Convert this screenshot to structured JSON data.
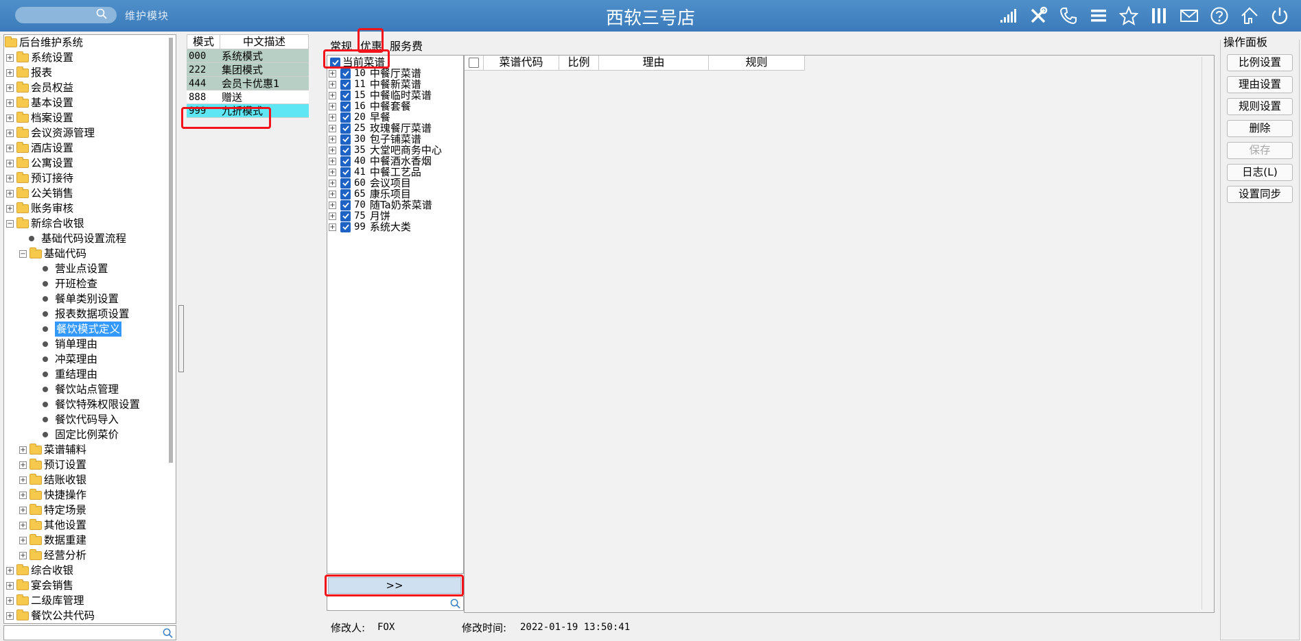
{
  "header": {
    "search_placeholder": "",
    "module_label": "维护模块",
    "title": "西软三号店",
    "icons": [
      "signal-icon",
      "tools-icon",
      "phone-icon",
      "menu-icon",
      "star-icon",
      "columns-icon",
      "mail-icon",
      "help-icon",
      "house-icon",
      "power-icon"
    ]
  },
  "tree": {
    "items": [
      {
        "label": "后台维护系统"
      },
      {
        "label": "系统设置"
      },
      {
        "label": "报表"
      },
      {
        "label": "会员权益"
      },
      {
        "label": "基本设置"
      },
      {
        "label": "档案设置"
      },
      {
        "label": "会议资源管理"
      },
      {
        "label": "酒店设置"
      },
      {
        "label": "公寓设置"
      },
      {
        "label": "预订接待"
      },
      {
        "label": "公关销售"
      },
      {
        "label": "账务审核"
      },
      {
        "label": "新综合收银"
      },
      {
        "label": "基础代码设置流程"
      },
      {
        "label": "基础代码"
      },
      {
        "label": "营业点设置"
      },
      {
        "label": "开班检查"
      },
      {
        "label": "餐单类别设置"
      },
      {
        "label": "报表数据项设置"
      },
      {
        "label": "餐饮模式定义"
      },
      {
        "label": "销单理由"
      },
      {
        "label": "冲菜理由"
      },
      {
        "label": "重结理由"
      },
      {
        "label": "餐饮站点管理"
      },
      {
        "label": "餐饮特殊权限设置"
      },
      {
        "label": "餐饮代码导入"
      },
      {
        "label": "固定比例菜价"
      },
      {
        "label": "菜谱辅料"
      },
      {
        "label": "预订设置"
      },
      {
        "label": "结账收银"
      },
      {
        "label": "快捷操作"
      },
      {
        "label": "特定场景"
      },
      {
        "label": "其他设置"
      },
      {
        "label": "数据重建"
      },
      {
        "label": "经营分析"
      },
      {
        "label": "综合收银"
      },
      {
        "label": "宴会销售"
      },
      {
        "label": "二级库管理"
      },
      {
        "label": "餐饮公共代码"
      }
    ],
    "selected": "餐饮模式定义"
  },
  "mode_table": {
    "headers": [
      "模式",
      "中文描述"
    ],
    "rows": [
      {
        "code": "000",
        "desc": "系统模式"
      },
      {
        "code": "222",
        "desc": "集团模式"
      },
      {
        "code": "444",
        "desc": "会员卡优惠1"
      },
      {
        "code": "888",
        "desc": "赠送"
      },
      {
        "code": "999",
        "desc": "九折模式"
      }
    ],
    "selected_code": "999"
  },
  "tabs": [
    "常规",
    "优惠",
    "服务费"
  ],
  "active_tab": "优惠",
  "categories": {
    "header_label": "当前菜谱",
    "items": [
      {
        "code": "10",
        "name": "中餐厅菜谱"
      },
      {
        "code": "11",
        "name": "中餐新菜谱"
      },
      {
        "code": "15",
        "name": "中餐临时菜谱"
      },
      {
        "code": "16",
        "name": "中餐套餐"
      },
      {
        "code": "20",
        "name": "早餐"
      },
      {
        "code": "25",
        "name": "玫瑰餐厅菜谱"
      },
      {
        "code": "30",
        "name": "包子铺菜谱"
      },
      {
        "code": "35",
        "name": "大堂吧商务中心"
      },
      {
        "code": "40",
        "name": "中餐酒水香烟"
      },
      {
        "code": "41",
        "name": "中餐工艺品"
      },
      {
        "code": "60",
        "name": "会议项目"
      },
      {
        "code": "65",
        "name": "康乐项目"
      },
      {
        "code": "70",
        "name": "随Ta奶茶菜谱"
      },
      {
        "code": "75",
        "name": "月饼"
      },
      {
        "code": "99",
        "name": "系统大类"
      }
    ],
    "move_label": ">>"
  },
  "grid": {
    "headers": [
      "菜谱代码",
      "比例",
      "理由",
      "规则"
    ]
  },
  "ops": {
    "title": "操作面板",
    "buttons": [
      {
        "label": "比例设置",
        "enabled": true
      },
      {
        "label": "理由设置",
        "enabled": true
      },
      {
        "label": "规则设置",
        "enabled": true
      },
      {
        "label": "删除",
        "enabled": true
      },
      {
        "label": "保存",
        "enabled": false
      },
      {
        "label": "日志(L)",
        "enabled": true
      },
      {
        "label": "设置同步",
        "enabled": true
      }
    ]
  },
  "footer": {
    "modifier_label": "修改人:",
    "modifier_value": "FOX",
    "modified_time_label": "修改时间:",
    "modified_time_value": "2022-01-19 13:50:41"
  },
  "colors": {
    "titlebar": "#3f80c0",
    "selection": "#3399ff",
    "highlight": "#f2121a",
    "checkbox": "#1e63c4"
  }
}
